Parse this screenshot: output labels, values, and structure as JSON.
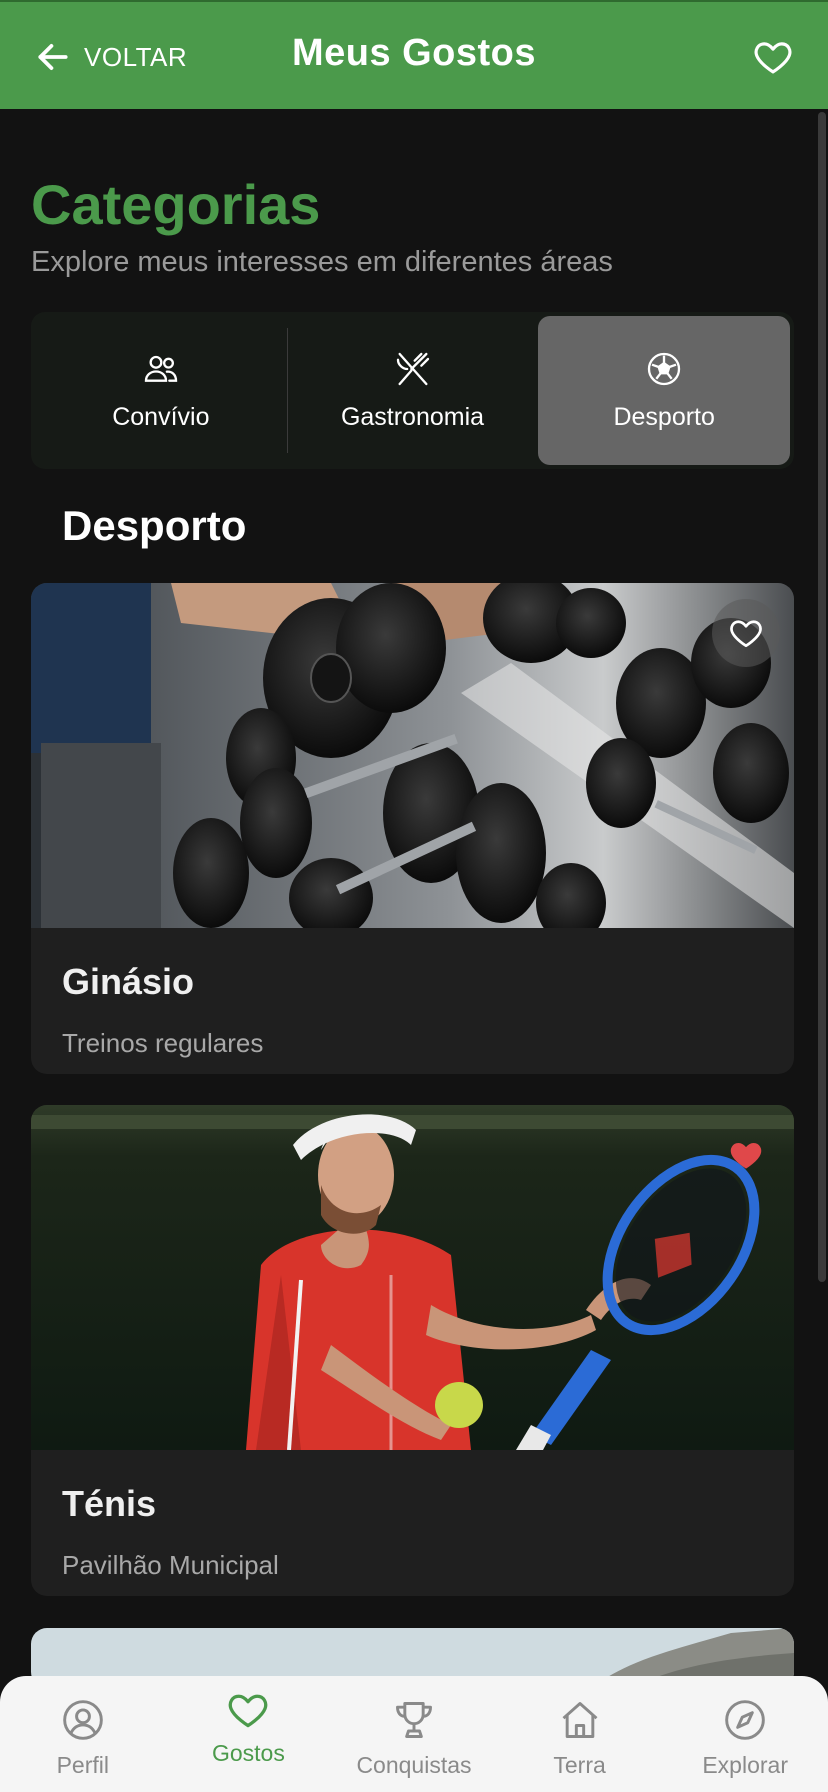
{
  "header": {
    "back_label": "VOLTAR",
    "title": "Meus Gostos"
  },
  "intro": {
    "title": "Categorias",
    "subtitle": "Explore meus interesses em diferentes áreas"
  },
  "tabs": [
    {
      "label": "Convívio",
      "icon": "people-icon",
      "active": false
    },
    {
      "label": "Gastronomia",
      "icon": "utensils-icon",
      "active": false
    },
    {
      "label": "Desporto",
      "icon": "soccer-ball-icon",
      "active": true
    }
  ],
  "section": {
    "title": "Desporto"
  },
  "cards": [
    {
      "title": "Ginásio",
      "description": "Treinos regulares",
      "favorite": false,
      "image": "dumbbell-rack-photo"
    },
    {
      "title": "Ténis",
      "description": "Pavilhão Municipal",
      "favorite": true,
      "image": "tennis-player-photo"
    }
  ],
  "bottom_nav": [
    {
      "label": "Perfil",
      "icon": "user-icon",
      "active": false
    },
    {
      "label": "Gostos",
      "icon": "heart-icon",
      "active": true
    },
    {
      "label": "Conquistas",
      "icon": "trophy-icon",
      "active": false
    },
    {
      "label": "Terra",
      "icon": "home-icon",
      "active": false
    },
    {
      "label": "Explorar",
      "icon": "compass-icon",
      "active": false
    }
  ],
  "colors": {
    "brand_green": "#4b9a4b",
    "background": "#121212",
    "card": "#1f1f1f",
    "favorite_red": "#e0484a"
  }
}
